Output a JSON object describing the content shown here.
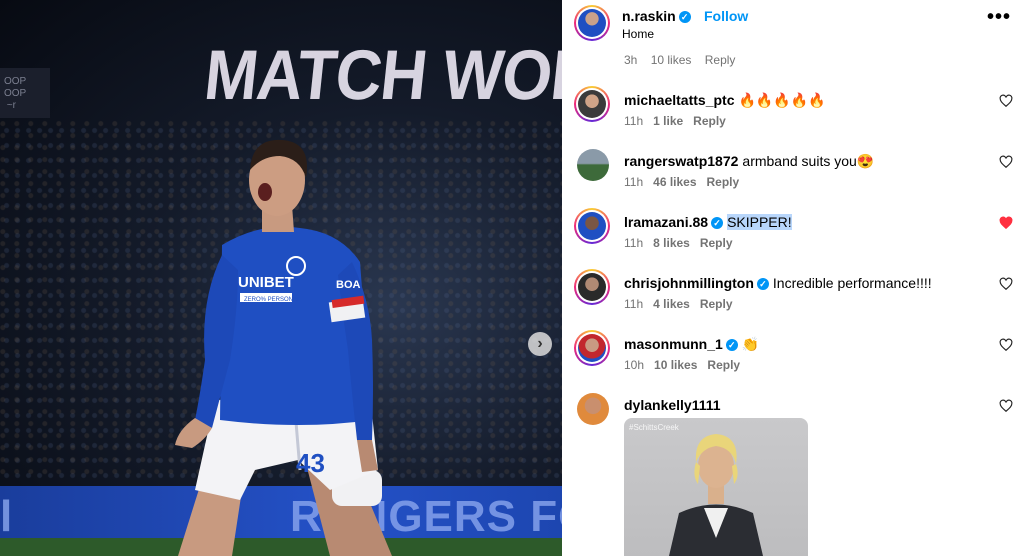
{
  "media": {
    "banner_text": "MATCH WORN &",
    "side_sign": "OOP\nOOP\n ~r",
    "ad_text": "RANGERS FO",
    "ad_text_left": "l",
    "shirt_sponsor": "UNIBET",
    "shirt_sub": "ZERO% PERSONAL",
    "shirt_number": "43",
    "armband": "BOA",
    "carousel_next": "›"
  },
  "header": {
    "username": "n.raskin",
    "follow_label": "Follow",
    "location": "Home",
    "more_label": "•••",
    "verified": true
  },
  "partial_comment": {
    "time": "3h",
    "likes": "10 likes",
    "reply": "Reply"
  },
  "comments": [
    {
      "user": "michaeltatts_ptc",
      "verified": false,
      "text": "🔥🔥🔥🔥🔥",
      "time": "11h",
      "likes": "1 like",
      "reply": "Reply",
      "liked": false
    },
    {
      "user": "rangerswatp1872",
      "verified": false,
      "text": "armband suits you😍",
      "time": "11h",
      "likes": "46 likes",
      "reply": "Reply",
      "liked": false
    },
    {
      "user": "lramazani.88",
      "verified": true,
      "text": "SKIPPER!",
      "time": "11h",
      "likes": "8 likes",
      "reply": "Reply",
      "liked": true
    },
    {
      "user": "chrisjohnmillington",
      "verified": true,
      "text": "Incredible performance!!!!",
      "time": "11h",
      "likes": "4 likes",
      "reply": "Reply",
      "liked": false
    },
    {
      "user": "masonmunn_1",
      "verified": true,
      "text": "👏",
      "time": "10h",
      "likes": "10 likes",
      "reply": "Reply",
      "liked": false
    },
    {
      "user": "dylankelly1111",
      "verified": false,
      "text": "",
      "time": "",
      "likes": "",
      "reply": "",
      "liked": false
    }
  ],
  "gif": {
    "tag": "#SchittsCreek"
  },
  "colors": {
    "accent": "#0095f6",
    "liked": "#ff3040",
    "meta": "#737373",
    "shirt": "#1f4fc2"
  }
}
